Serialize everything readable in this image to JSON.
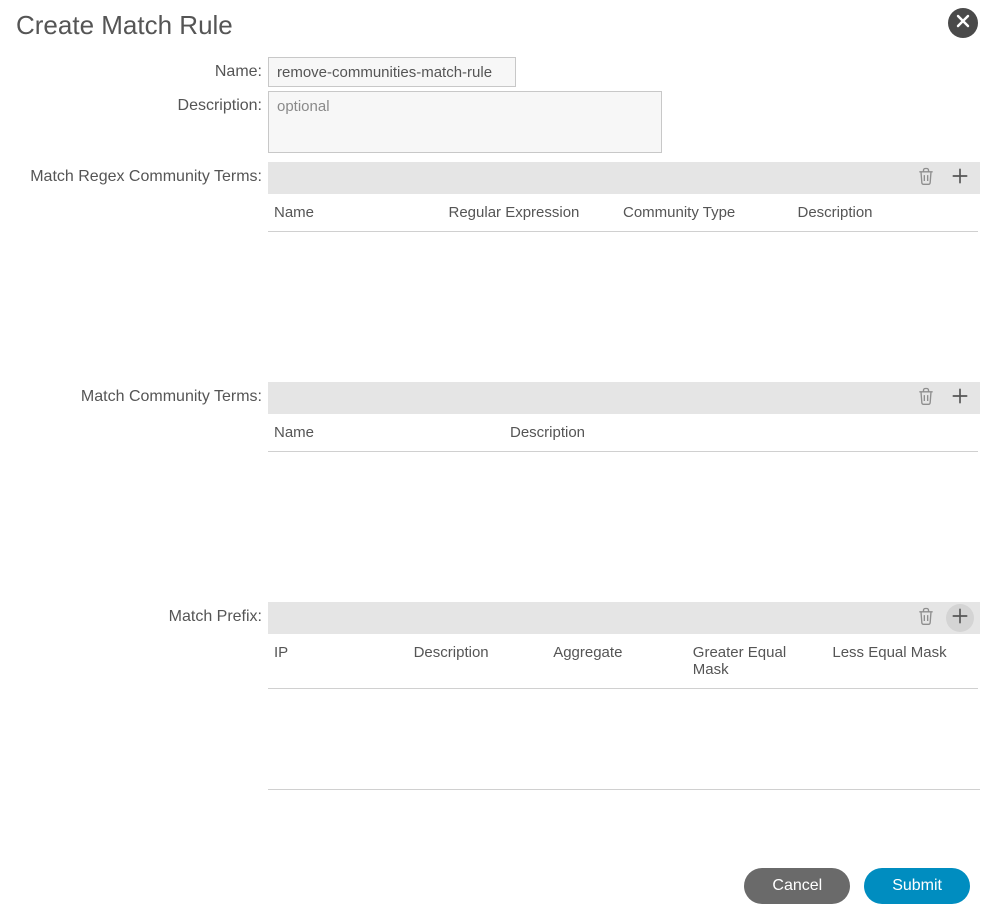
{
  "title": "Create Match Rule",
  "fields": {
    "name": {
      "label": "Name:",
      "value": "remove-communities-match-rule"
    },
    "description": {
      "label": "Description:",
      "placeholder": "optional",
      "value": ""
    }
  },
  "sections": {
    "regex": {
      "label": "Match Regex Community Terms:",
      "columns": [
        "Name",
        "Regular Expression",
        "Community Type",
        "Description"
      ]
    },
    "community": {
      "label": "Match Community Terms:",
      "columns": [
        "Name",
        "Description"
      ]
    },
    "prefix": {
      "label": "Match Prefix:",
      "columns": [
        "IP",
        "Description",
        "Aggregate",
        "Greater Equal Mask",
        "Less Equal Mask"
      ]
    }
  },
  "footer": {
    "cancel": "Cancel",
    "submit": "Submit"
  }
}
